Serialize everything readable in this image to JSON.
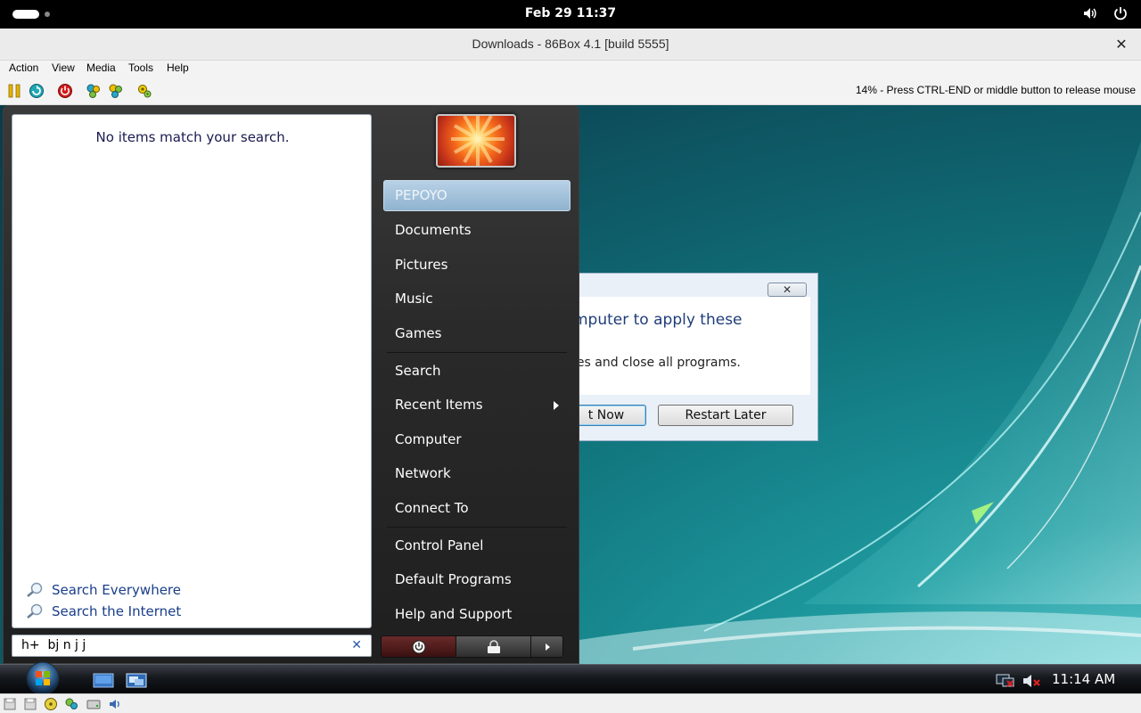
{
  "gnome": {
    "clock": "Feb 29  11:37"
  },
  "window": {
    "title": "Downloads - 86Box 4.1 [build 5555]",
    "close_glyph": "✕"
  },
  "menu": {
    "action": "Action",
    "view": "View",
    "media": "Media",
    "tools": "Tools",
    "help": "Help"
  },
  "toolbar": {
    "status": "14% - Press CTRL-END or middle button to release mouse",
    "buttons": [
      "pause-icon",
      "hard-reset-icon",
      "power-icon",
      "ctrl-alt-del-icon",
      "ctrl-alt-esc-icon",
      "settings-icon"
    ]
  },
  "dialog": {
    "message_line1": "mputer to apply these",
    "message_line2": "les and close all programs.",
    "restart_now": "t Now",
    "restart_later": "Restart Later",
    "close_glyph": "✕"
  },
  "start_menu": {
    "no_results": "No items match your search.",
    "search_everywhere": "Search Everywhere",
    "search_internet": "Search the Internet",
    "search_query": "h+  bj n j j",
    "clear_glyph": "✕",
    "user_name": "PEPOYO",
    "right_items": {
      "documents": "Documents",
      "pictures": "Pictures",
      "music": "Music",
      "games": "Games",
      "search": "Search",
      "recent_items": "Recent Items",
      "computer": "Computer",
      "network": "Network",
      "connect_to": "Connect To",
      "control_panel": "Control Panel",
      "default_programs": "Default Programs",
      "help_support": "Help and Support"
    }
  },
  "taskbar": {
    "clock": "11:14 AM"
  },
  "colors": {
    "desktop_teal": "#10717a",
    "start_menu_dark": "#2a2a2a",
    "user_highlight": "#8fb3cf",
    "power_red": "#6a2a2a",
    "link_blue": "#1a3e8a"
  }
}
